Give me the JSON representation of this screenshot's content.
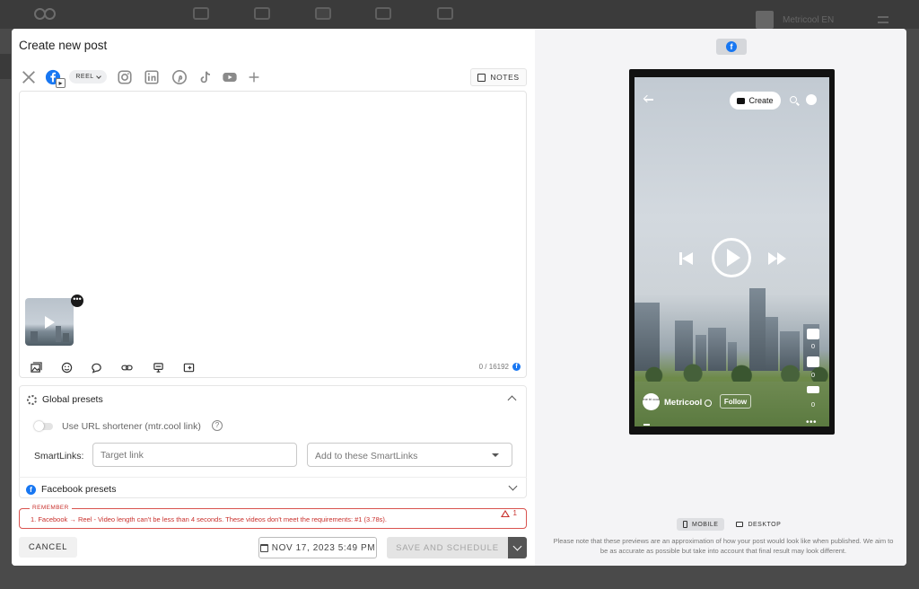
{
  "background_app": {
    "account_name": "Metricool EN"
  },
  "modal": {
    "title": "Create new post",
    "networks": [
      {
        "name": "x",
        "icon": "x-twitter-icon"
      },
      {
        "name": "facebook",
        "icon": "facebook-icon",
        "selected": true
      },
      {
        "name": "instagram",
        "icon": "instagram-icon"
      },
      {
        "name": "linkedin",
        "icon": "linkedin-icon"
      },
      {
        "name": "pinterest",
        "icon": "pinterest-icon"
      },
      {
        "name": "tiktok",
        "icon": "tiktok-icon"
      },
      {
        "name": "youtube",
        "icon": "youtube-icon"
      },
      {
        "name": "add",
        "icon": "plus-icon"
      }
    ],
    "post_type": "REEL",
    "notes_label": "NOTES",
    "editor": {
      "text": "",
      "char_counter": "0 / 16192",
      "toolbar": [
        "media-icon",
        "emoji-icon",
        "comment-icon",
        "link-icon",
        "hashtag-icon",
        "preview-icon"
      ]
    },
    "global_presets": {
      "title": "Global presets",
      "url_shortener_label": "Use URL shortener (mtr.cool link)",
      "url_shortener_on": false,
      "help_glyph": "?",
      "smartlinks_label": "SmartLinks:",
      "target_link_placeholder": "Target link",
      "add_smartlinks_placeholder": "Add to these SmartLinks"
    },
    "facebook_presets": {
      "title": "Facebook presets"
    },
    "remember": {
      "label": "REMEMBER",
      "message": "1. Facebook → Reel - Video length can't be less than 4 seconds. These videos don't meet the requirements: #1 (3.78s).",
      "count": "1"
    },
    "footer": {
      "cancel_label": "CANCEL",
      "date_label": "NOV 17, 2023 5:49 PM",
      "save_label": "SAVE AND SCHEDULE"
    }
  },
  "preview": {
    "network": "facebook",
    "create_label": "Create",
    "account_name": "Metricool",
    "avatar_text": "me tri cool",
    "follow_label": "Follow",
    "likes": "0",
    "comments": "0",
    "shares": "0",
    "view_tabs": [
      {
        "label": "MOBILE",
        "active": true
      },
      {
        "label": "DESKTOP",
        "active": false
      }
    ],
    "disclaimer": "Please note that these previews are an approximation of how your post would look like when published. We aim to be as accurate as possible but take into account that final result may look different."
  },
  "colors": {
    "facebook_blue": "#1877f2",
    "error_red": "#c9302c",
    "overlay": "#4a4a4a"
  }
}
